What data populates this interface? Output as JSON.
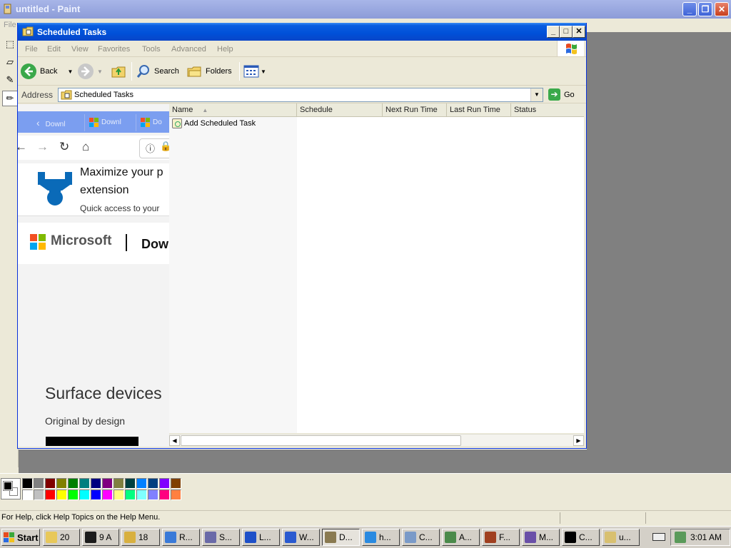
{
  "paint": {
    "title": "untitled - Paint",
    "menu_file": "File",
    "status_text": "For Help, click Help Topics on the Help Menu.",
    "controls": {
      "minimize": "_",
      "maximize": "❐",
      "close": "✕"
    }
  },
  "palette": {
    "colors": [
      "#000000",
      "#808080",
      "#800000",
      "#808000",
      "#008000",
      "#008080",
      "#000080",
      "#800080",
      "#808040",
      "#004040",
      "#0080ff",
      "#004080",
      "#8000ff",
      "#804000",
      "#ffffff",
      "#c0c0c0",
      "#ff0000",
      "#ffff00",
      "#00ff00",
      "#00ffff",
      "#0000ff",
      "#ff00ff",
      "#ffff80",
      "#00ff80",
      "#80ffff",
      "#8080ff",
      "#ff0080",
      "#ff8040"
    ]
  },
  "explorer": {
    "title": "Scheduled Tasks",
    "menu": [
      "File",
      "Edit",
      "View",
      "Favorites",
      "Tools",
      "Advanced",
      "Help"
    ],
    "toolbar": {
      "back": "Back",
      "search": "Search",
      "folders": "Folders"
    },
    "address_label": "Address",
    "address_value": "Scheduled Tasks",
    "go": "Go",
    "columns": [
      "Name",
      "Schedule",
      "Next Run Time",
      "Last Run Time",
      "Status"
    ],
    "items": [
      {
        "name": "Add Scheduled Task"
      }
    ]
  },
  "ghost": {
    "tabs": [
      "Downl",
      "Downl",
      "Do"
    ],
    "card_line1": "Maximize your p",
    "card_line2": "extension",
    "card_line3": "Quick access to your",
    "ms_text": "Microsoft",
    "ms_dow": "Dow",
    "surface": "Surface devices",
    "original": "Original by design"
  },
  "taskbar": {
    "start": "Start",
    "tasks": [
      {
        "label": "20",
        "color": "#e8c85a"
      },
      {
        "label": "9 A",
        "color": "#1c1c1c"
      },
      {
        "label": "18",
        "color": "#d8b040"
      },
      {
        "label": "R...",
        "color": "#3a7ad8"
      },
      {
        "label": "S...",
        "color": "#6a6aa8"
      },
      {
        "label": "L...",
        "color": "#1e50c8"
      },
      {
        "label": "W...",
        "color": "#2a5ad0"
      },
      {
        "label": "D...",
        "color": "#8a7a50"
      },
      {
        "label": "h...",
        "color": "#2a8ae0"
      },
      {
        "label": "C...",
        "color": "#7a9ac8"
      },
      {
        "label": "A...",
        "color": "#4a8a4a"
      },
      {
        "label": "F...",
        "color": "#a04020"
      },
      {
        "label": "M...",
        "color": "#6a50a8"
      },
      {
        "label": "C...",
        "color": "#000000"
      },
      {
        "label": "u...",
        "color": "#d8c070"
      }
    ],
    "clock": "3:01 AM"
  }
}
